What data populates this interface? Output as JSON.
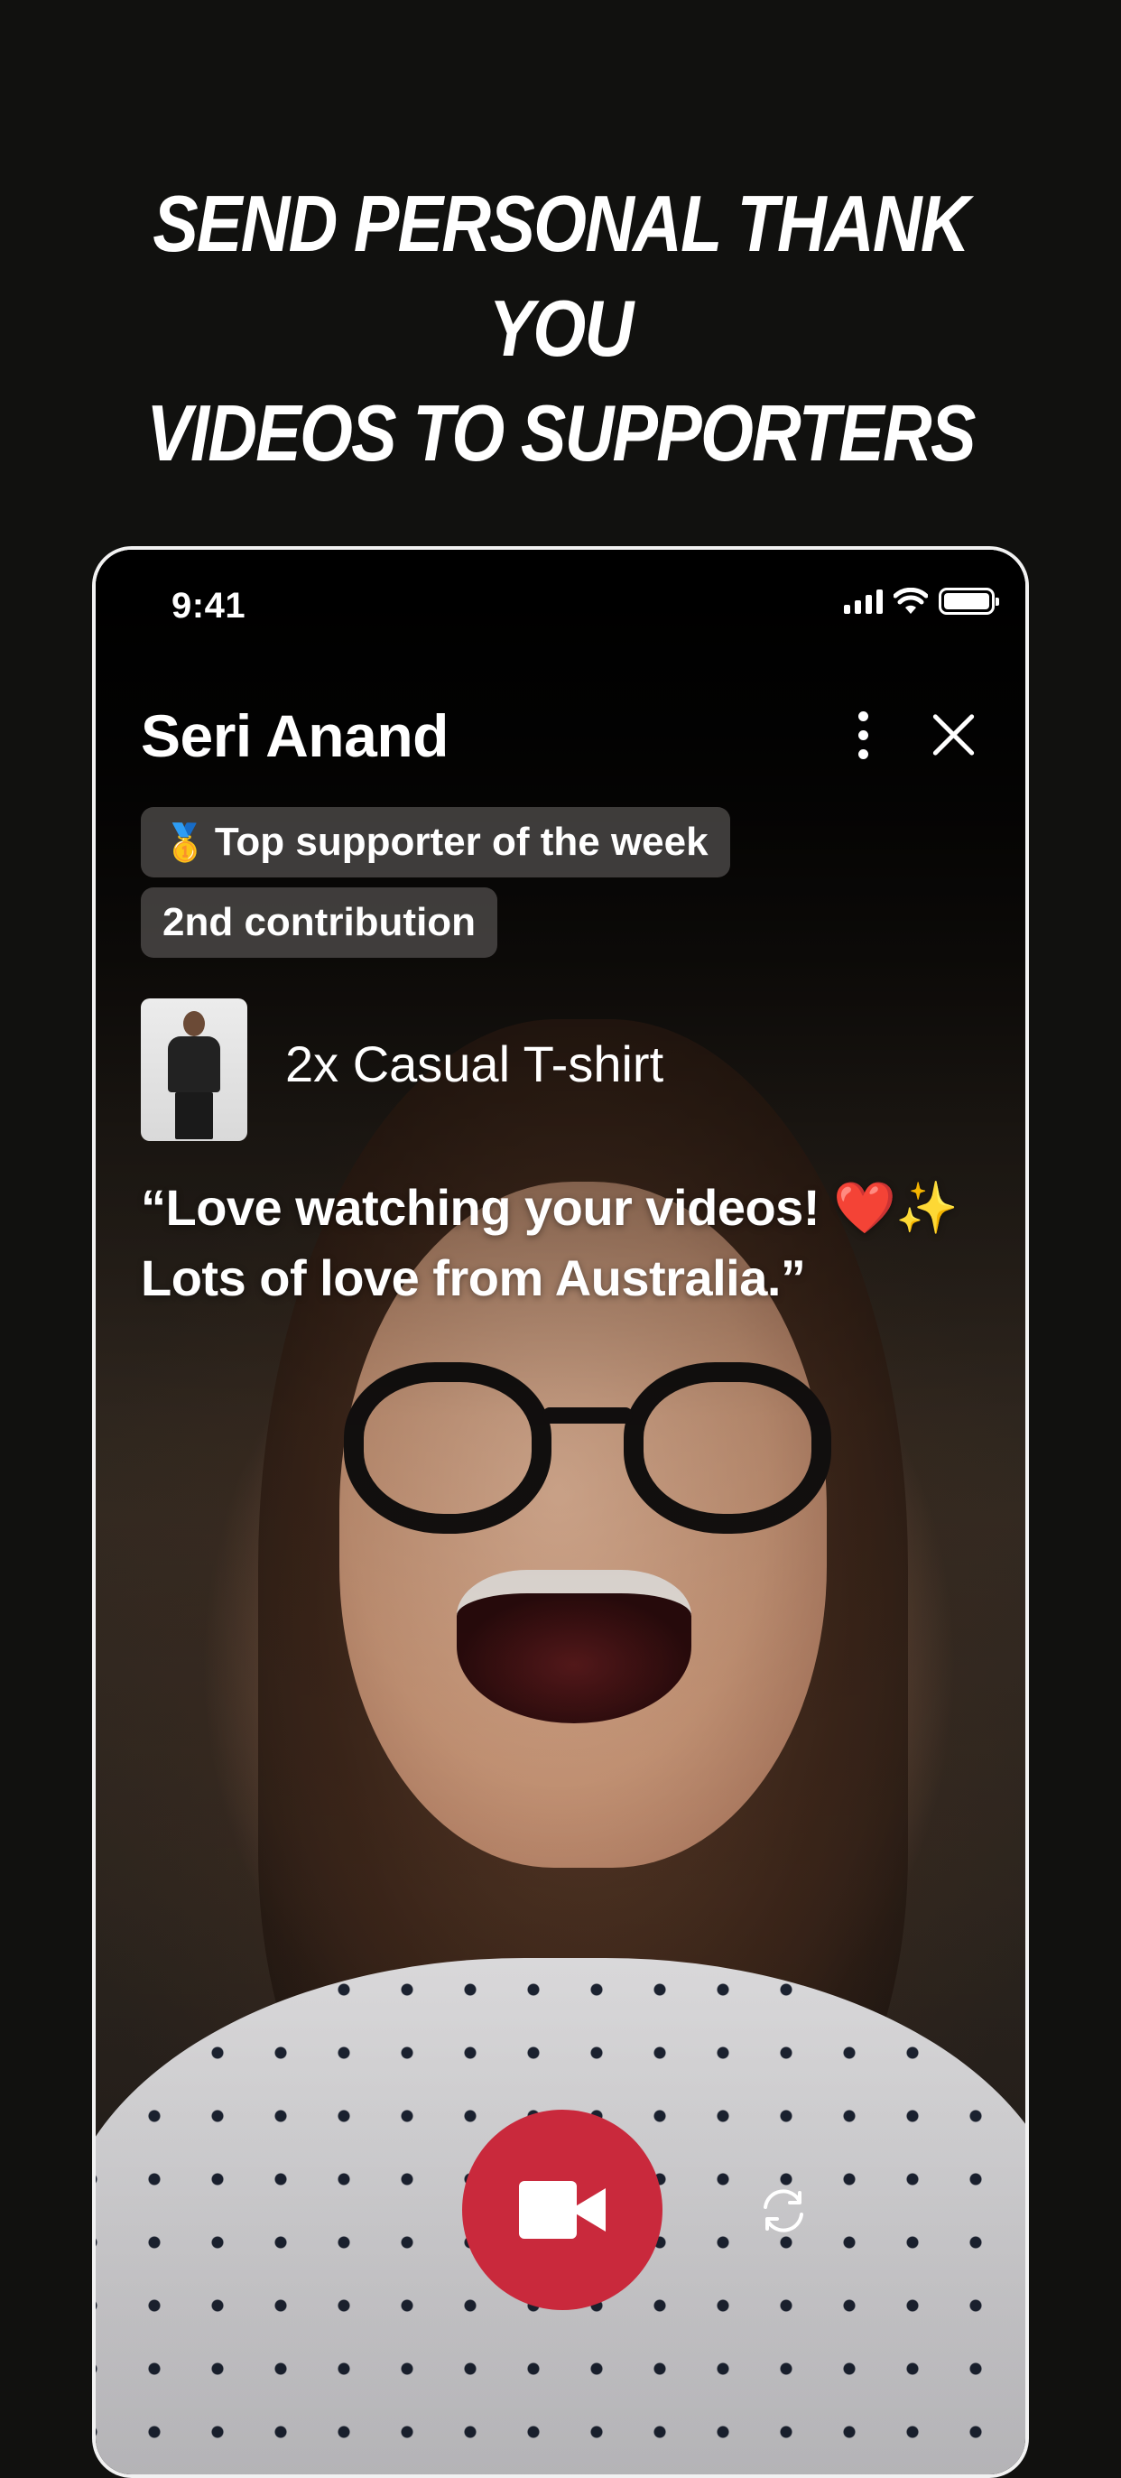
{
  "headline": {
    "line1": "SEND PERSONAL THANK YOU",
    "line2": "VIDEOS TO SUPPORTERS"
  },
  "status_bar": {
    "time": "9:41",
    "icons": [
      "signal-icon",
      "wifi-icon",
      "battery-icon"
    ]
  },
  "header": {
    "name": "Seri Anand",
    "more_icon": "more-vertical-icon",
    "close_icon": "close-icon"
  },
  "badges": {
    "top_supporter": {
      "emoji": "🥇",
      "label": "Top supporter of the week"
    },
    "contribution": {
      "label": "2nd contribution"
    }
  },
  "product": {
    "title": "2x Casual T-shirt"
  },
  "message": {
    "text": "“Love watching your videos! ❤️✨ Lots of love from Australia.”"
  },
  "controls": {
    "record_icon": "video-camera-icon",
    "flip_icon": "flip-camera-icon"
  },
  "colors": {
    "background": "#11110f",
    "record_button": "#c9293c",
    "badge_bg": "#555250"
  }
}
